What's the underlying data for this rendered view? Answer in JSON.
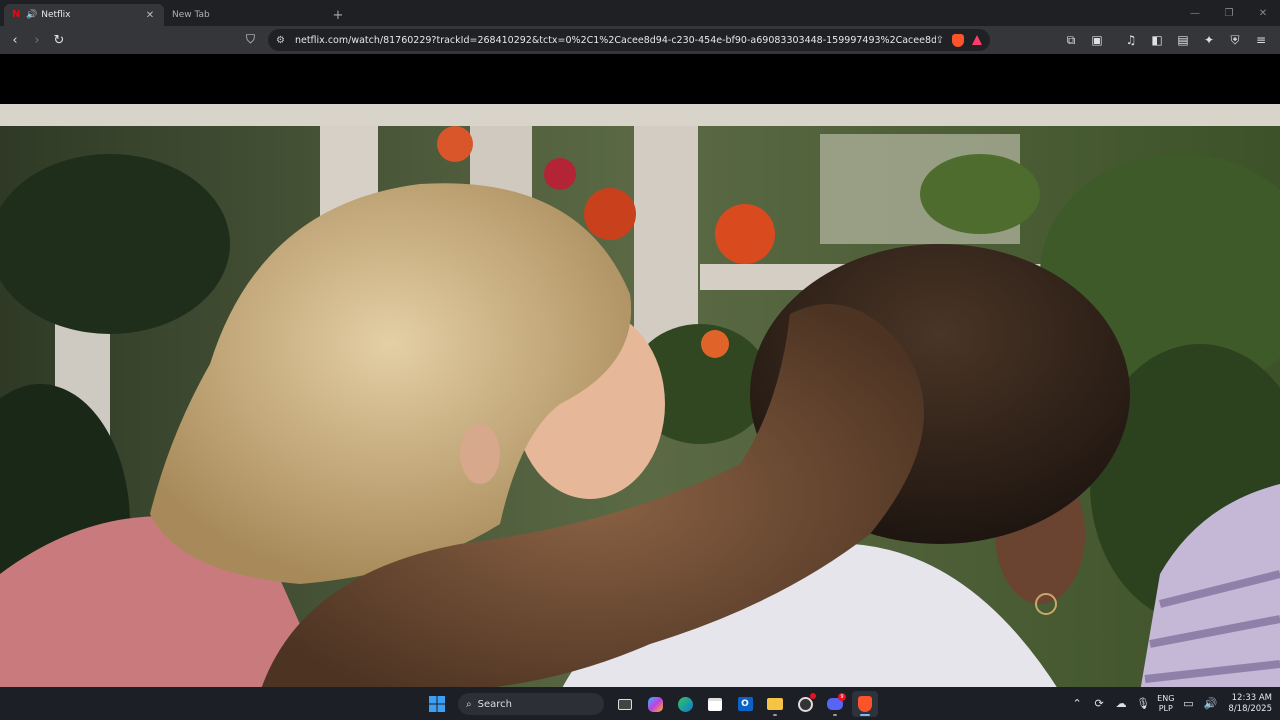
{
  "tabs": [
    {
      "title": "Netflix",
      "active": true
    },
    {
      "title": "New Tab",
      "active": false
    }
  ],
  "new_tab_symbol": "+",
  "address_bar": {
    "url": "netflix.com/watch/81760229?trackId=268410292&tctx=0%2C1%2Cacee8d94-c230-454e-bf90-a69083303448-159997493%2Cacee8d94-c230-454e-b..."
  },
  "taskbar": {
    "search_label": "Search",
    "language_line1": "ENG",
    "language_line2": "PLP",
    "time": "12:33 AM",
    "date": "8/18/2025",
    "discord_badge": "9"
  },
  "colors": {
    "brand_netflix": "#e50914",
    "brave_orange": "#fb542b"
  }
}
